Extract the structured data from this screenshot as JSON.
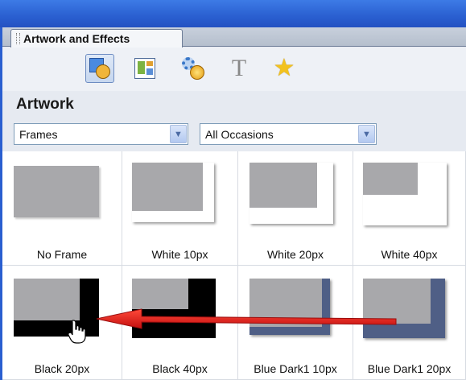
{
  "panel": {
    "tab_label": "Artwork and Effects",
    "section_title": "Artwork"
  },
  "toolbar": {
    "tools": [
      {
        "name": "artwork-tool",
        "icon": "artwork-icon",
        "selected": true
      },
      {
        "name": "layout-tool",
        "icon": "layout-icon",
        "selected": false
      },
      {
        "name": "effects-tool",
        "icon": "effects-icon",
        "selected": false
      },
      {
        "name": "text-tool",
        "icon": "text-icon",
        "glyph": "T",
        "selected": false
      },
      {
        "name": "favorites-tool",
        "icon": "star-icon",
        "glyph": "★",
        "selected": false
      }
    ]
  },
  "filters": {
    "category": "Frames",
    "occasion": "All Occasions"
  },
  "frames": [
    {
      "label": "No Frame",
      "style": "none"
    },
    {
      "label": "White 10px",
      "style": "white",
      "color": "#ffffff"
    },
    {
      "label": "White 20px",
      "style": "white",
      "color": "#ffffff"
    },
    {
      "label": "White 40px",
      "style": "white",
      "color": "#ffffff"
    },
    {
      "label": "Black 20px",
      "style": "black",
      "color": "#000000"
    },
    {
      "label": "Black 40px",
      "style": "black",
      "color": "#000000"
    },
    {
      "label": "Blue Dark1 10px",
      "style": "blue",
      "color": "#4f5f86"
    },
    {
      "label": "Blue Dark1 20px",
      "style": "blue",
      "color": "#4f5f86"
    }
  ],
  "colors": {
    "title_bar": "#2a5fd0",
    "annotation_arrow": "#e01b1b",
    "thumb_gray": "#a8a8ab"
  }
}
